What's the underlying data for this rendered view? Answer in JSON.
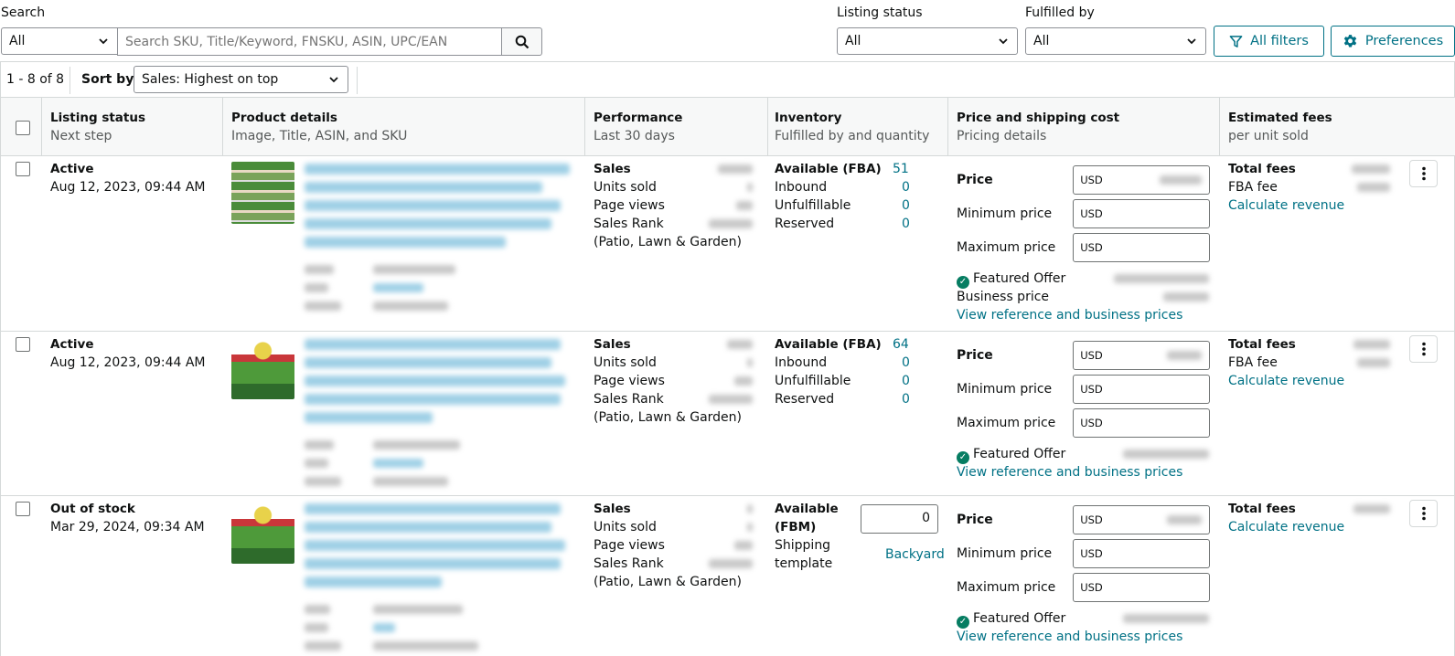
{
  "filters": {
    "search_label": "Search",
    "search_scope": "All",
    "search_placeholder": "Search SKU, Title/Keyword, FNSKU, ASIN, UPC/EAN",
    "listing_status_label": "Listing status",
    "listing_status_value": "All",
    "fulfilled_by_label": "Fulfilled by",
    "fulfilled_by_value": "All",
    "all_filters_label": "All filters",
    "preferences_label": "Preferences"
  },
  "toolbar": {
    "count": "1 - 8 of 8",
    "sort_label": "Sort by:",
    "sort_value": "Sales: Highest on top"
  },
  "columns": [
    {
      "title": "Listing status",
      "sub": "Next step"
    },
    {
      "title": "Product details",
      "sub": "Image, Title, ASIN, and SKU"
    },
    {
      "title": "Performance",
      "sub": "Last 30 days"
    },
    {
      "title": "Inventory",
      "sub": "Fulfilled by and quantity"
    },
    {
      "title": "Price and shipping cost",
      "sub": "Pricing details"
    },
    {
      "title": "Estimated fees",
      "sub": "per unit sold"
    }
  ],
  "rows": [
    {
      "status": "Active",
      "date": "Aug 12, 2023, 09:44 AM",
      "perf": [
        "Sales",
        "Units sold",
        "Page views",
        "Sales Rank",
        "(Patio, Lawn & Garden)"
      ],
      "inv": [
        {
          "label": "Available (FBA)",
          "value": "51"
        },
        {
          "label": "Inbound",
          "value": "0"
        },
        {
          "label": "Unfulfillable",
          "value": "0"
        },
        {
          "label": "Reserved",
          "value": "0"
        }
      ],
      "price_labels": [
        "Price",
        "Minimum price",
        "Maximum price"
      ],
      "currency": "USD",
      "featured": "Featured Offer",
      "business": "Business price",
      "ref_link": "View reference and business prices",
      "fees_title": "Total fees",
      "fees_sub": "FBA fee",
      "calc_link": "Calculate revenue"
    },
    {
      "status": "Active",
      "date": "Aug 12, 2023, 09:44 AM",
      "perf": [
        "Sales",
        "Units sold",
        "Page views",
        "Sales Rank",
        "(Patio, Lawn & Garden)"
      ],
      "inv": [
        {
          "label": "Available (FBA)",
          "value": "64"
        },
        {
          "label": "Inbound",
          "value": "0"
        },
        {
          "label": "Unfulfillable",
          "value": "0"
        },
        {
          "label": "Reserved",
          "value": "0"
        }
      ],
      "price_labels": [
        "Price",
        "Minimum price",
        "Maximum price"
      ],
      "currency": "USD",
      "featured": "Featured Offer",
      "ref_link": "View reference and business prices",
      "fees_title": "Total fees",
      "fees_sub": "FBA fee",
      "calc_link": "Calculate revenue"
    },
    {
      "status": "Out of stock",
      "date": "Mar 29, 2024, 09:34 AM",
      "perf": [
        "Sales",
        "Units sold",
        "Page views",
        "Sales Rank",
        "(Patio, Lawn & Garden)"
      ],
      "inv_fbm": {
        "label_1": "Available",
        "label_2": "(FBM)",
        "qty": "0",
        "ship_1": "Shipping",
        "ship_2": "template",
        "template": "Backyard"
      },
      "price_labels": [
        "Price",
        "Minimum price",
        "Maximum price"
      ],
      "currency": "USD",
      "featured": "Featured Offer",
      "ref_link": "View reference and business prices",
      "fees_title": "Total fees",
      "calc_link": "Calculate revenue"
    }
  ],
  "colors": {
    "link": "#007185",
    "border": "#d5d9d9",
    "success": "#067d62"
  }
}
